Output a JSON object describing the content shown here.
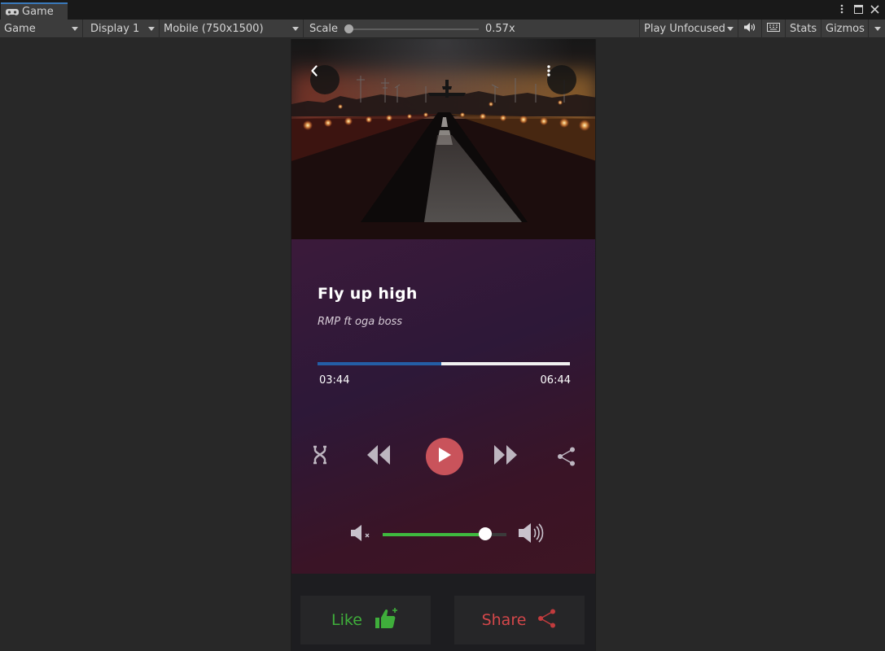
{
  "tab": {
    "title": "Game"
  },
  "toolbar": {
    "game_label": "Game",
    "display_label": "Display 1",
    "resolution_label": "Mobile (750x1500)",
    "scale_label": "Scale",
    "scale_value": "0.57x",
    "play_label": "Play Unfocused",
    "stats_label": "Stats",
    "gizmos_label": "Gizmos"
  },
  "player": {
    "title": "Fly up high",
    "artist": "RMP ft oga boss",
    "current_time": "03:44",
    "total_time": "06:44",
    "progress": 0.49,
    "volume": 0.83
  },
  "actions": {
    "like_label": "Like",
    "share_label": "Share"
  },
  "colors": {
    "play_button": "#c9535b",
    "seek_fill": "#245ea6",
    "volume_fill": "#3fba3f",
    "like": "#3fae3b",
    "share": "#d4474a"
  },
  "icons": {
    "back": "back-icon",
    "more": "more-vertical-icon",
    "shuffle": "shuffle-icon",
    "rewind": "rewind-icon",
    "play": "play-icon",
    "forward": "fast-forward-icon",
    "share": "share-icon",
    "mute": "mute-icon",
    "volume": "volume-icon",
    "like": "thumbs-up-icon"
  }
}
